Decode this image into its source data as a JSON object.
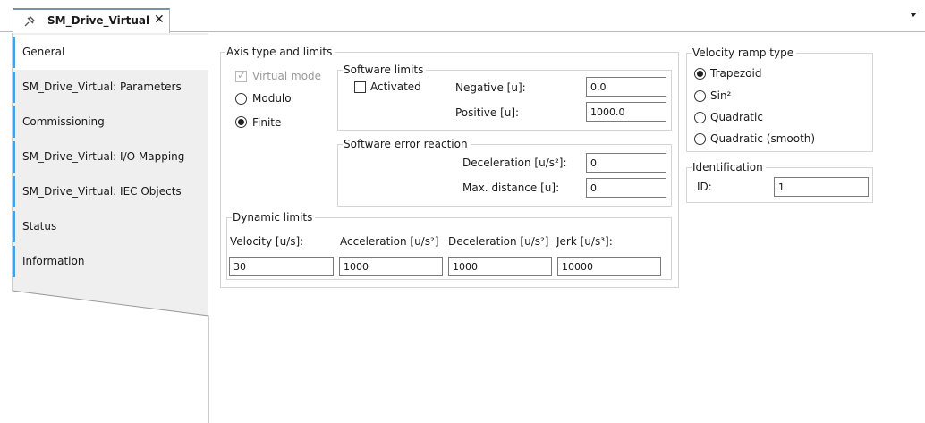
{
  "document_tab": {
    "title": "SM_Drive_Virtual",
    "close_glyph": "✕",
    "icon": "pin-icon"
  },
  "side_tabs": [
    {
      "label": "General",
      "active": true
    },
    {
      "label": "SM_Drive_Virtual: Parameters",
      "active": false
    },
    {
      "label": "Commissioning",
      "active": false
    },
    {
      "label": "SM_Drive_Virtual: I/O Mapping",
      "active": false
    },
    {
      "label": "SM_Drive_Virtual: IEC Objects",
      "active": false
    },
    {
      "label": "Status",
      "active": false
    },
    {
      "label": "Information",
      "active": false
    }
  ],
  "axis_type": {
    "legend": "Axis type and limits",
    "virtual_mode": {
      "label": "Virtual mode",
      "checked": true,
      "disabled": true
    },
    "modulo": {
      "label": "Modulo",
      "selected": false
    },
    "finite": {
      "label": "Finite",
      "selected": true
    }
  },
  "software_limits": {
    "legend": "Software limits",
    "activated": {
      "label": "Activated",
      "checked": false
    },
    "negative": {
      "label": "Negative [u]:",
      "value": "0.0"
    },
    "positive": {
      "label": "Positive [u]:",
      "value": "1000.0"
    }
  },
  "software_error_reaction": {
    "legend": "Software error reaction",
    "deceleration": {
      "label": "Deceleration [u/s²]:",
      "value": "0"
    },
    "max_distance": {
      "label": "Max. distance [u]:",
      "value": "0"
    }
  },
  "dynamic_limits": {
    "legend": "Dynamic limits",
    "velocity": {
      "label": "Velocity [u/s]:",
      "value": "30"
    },
    "acceleration": {
      "label": "Acceleration [u/s²]",
      "value": "1000"
    },
    "deceleration": {
      "label": "Deceleration [u/s²]",
      "value": "1000"
    },
    "jerk": {
      "label": "Jerk [u/s³]:",
      "value": "10000"
    }
  },
  "velocity_ramp": {
    "legend": "Velocity ramp type",
    "options": [
      {
        "label": "Trapezoid",
        "selected": true
      },
      {
        "label": "Sin²",
        "selected": false
      },
      {
        "label": "Quadratic",
        "selected": false
      },
      {
        "label": "Quadratic (smooth)",
        "selected": false
      }
    ]
  },
  "identification": {
    "legend": "Identification",
    "id": {
      "label": "ID:",
      "value": "1"
    }
  },
  "colors": {
    "tab_accent": "#4a9fe0",
    "inactive_tab": "#efefef",
    "group_border": "#d5d5d5"
  }
}
